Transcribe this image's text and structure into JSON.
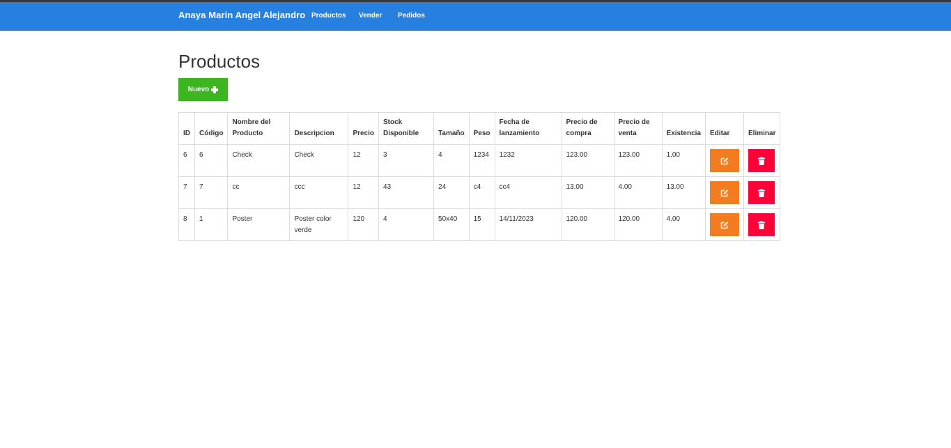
{
  "navbar": {
    "brand": "Anaya Marin Angel Alejandro",
    "links": [
      "Productos",
      "Vender",
      "Pedidos"
    ]
  },
  "page": {
    "title": "Productos",
    "new_button_label": "Nuevo"
  },
  "table": {
    "headers": {
      "id": "ID",
      "codigo": "Código",
      "nombre": "Nombre del Producto",
      "descripcion": "Descripcion",
      "precio": "Precio",
      "stock": "Stock Disponible",
      "tamano": "Tamaño",
      "peso": "Peso",
      "fecha": "Fecha de lanzamiento",
      "precio_compra": "Precio de compra",
      "precio_venta": "Precio de venta",
      "existencia": "Existencia",
      "editar": "Editar",
      "eliminar": "Eliminar"
    },
    "rows": [
      {
        "id": "6",
        "codigo": "6",
        "nombre": "Check",
        "descripcion": "Check",
        "precio": "12",
        "stock": "3",
        "tamano": "4",
        "peso": "1234",
        "fecha": "1232",
        "precio_compra": "123.00",
        "precio_venta": "123.00",
        "existencia": "1.00"
      },
      {
        "id": "7",
        "codigo": "7",
        "nombre": "cc",
        "descripcion": "ccc",
        "precio": "12",
        "stock": "43",
        "tamano": "24",
        "peso": "c4",
        "fecha": "cc4",
        "precio_compra": "13.00",
        "precio_venta": "4.00",
        "existencia": "13.00"
      },
      {
        "id": "8",
        "codigo": "1",
        "nombre": "Poster",
        "descripcion": "Poster color verde",
        "precio": "120",
        "stock": "4",
        "tamano": "50x40",
        "peso": "15",
        "fecha": "14/11/2023",
        "precio_compra": "120.00",
        "precio_venta": "120.00",
        "existencia": "4.00"
      }
    ]
  },
  "icons": {
    "new": "plus-icon",
    "edit": "edit-icon",
    "delete": "trash-icon"
  },
  "colors": {
    "navbar": "#2580e0",
    "new_button": "#3cb521",
    "edit_button": "#f47c20",
    "delete_button": "#ff0039"
  }
}
